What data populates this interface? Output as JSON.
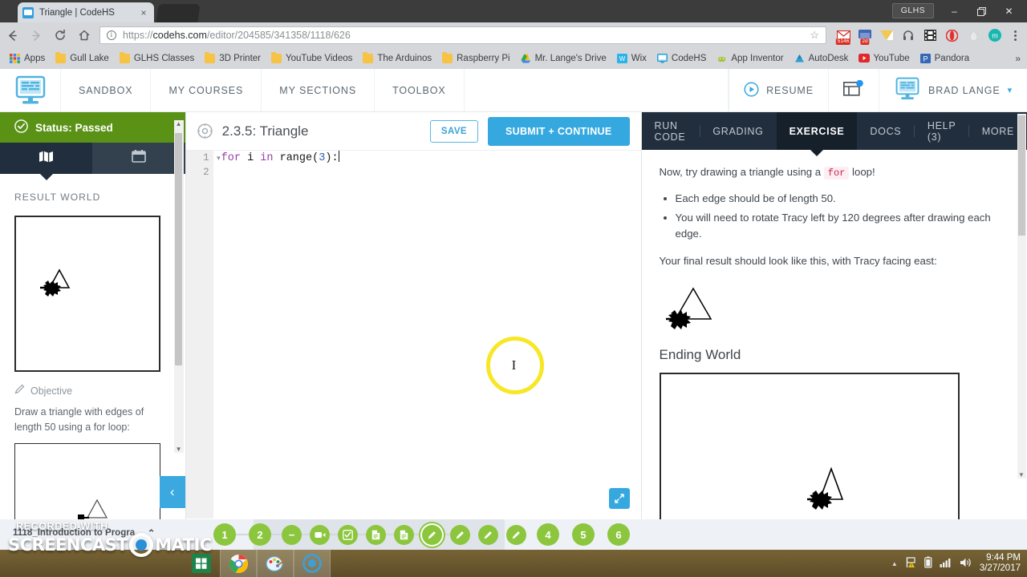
{
  "browser": {
    "tab": {
      "title": "Triangle | CodeHS",
      "favicon": "codehs-icon",
      "close": "×"
    },
    "url": {
      "scheme": "https://",
      "domain": "codehs.com",
      "path": "/editor/204585/341358/1118/626"
    },
    "nav": {
      "back": "←",
      "forward": "→",
      "reload": "⟳",
      "home": "⌂",
      "star": "☆",
      "menu": "chrome-menu-icon"
    },
    "window": {
      "profile": "GLHS",
      "minimize": "–",
      "maximize": "❐",
      "close": "✕"
    },
    "extensions": [
      {
        "name": "gmail-extension-icon",
        "badge": "5146"
      },
      {
        "name": "facebook-extension-icon",
        "badge": "2d"
      },
      {
        "name": "mail-extension-icon",
        "badge": ""
      },
      {
        "name": "headphones-extension-icon",
        "badge": ""
      },
      {
        "name": "film-extension-icon",
        "badge": ""
      },
      {
        "name": "opera-extension-icon",
        "badge": ""
      },
      {
        "name": "water-drop-extension-icon",
        "badge": ""
      },
      {
        "name": "mega-extension-icon",
        "badge": ""
      }
    ],
    "bookmarks": [
      {
        "label": "Apps",
        "icon": "apps-grid-icon"
      },
      {
        "label": "Gull Lake",
        "icon": "folder-icon"
      },
      {
        "label": "GLHS Classes",
        "icon": "folder-icon"
      },
      {
        "label": "3D Printer",
        "icon": "folder-icon"
      },
      {
        "label": "YouTube Videos",
        "icon": "folder-icon"
      },
      {
        "label": "The Arduinos",
        "icon": "folder-icon"
      },
      {
        "label": "Raspberry Pi",
        "icon": "folder-icon"
      },
      {
        "label": "Mr. Lange's Drive",
        "icon": "google-drive-icon"
      },
      {
        "label": "Wix",
        "icon": "wix-icon"
      },
      {
        "label": "CodeHS",
        "icon": "codehs-icon"
      },
      {
        "label": "App Inventor",
        "icon": "app-inventor-icon"
      },
      {
        "label": "AutoDesk",
        "icon": "autodesk-icon"
      },
      {
        "label": "YouTube",
        "icon": "youtube-icon"
      },
      {
        "label": "Pandora",
        "icon": "pandora-icon"
      }
    ],
    "bookmarks_overflow": "»"
  },
  "appnav": {
    "logo": "codehs-logo-icon",
    "items": [
      {
        "label": "SANDBOX"
      },
      {
        "label": "MY COURSES"
      },
      {
        "label": "MY SECTIONS"
      },
      {
        "label": "TOOLBOX"
      }
    ],
    "resume": {
      "label": "RESUME",
      "icon": "play-circle-icon"
    },
    "notifications": {
      "icon": "window-notification-icon",
      "has_dot": true
    },
    "user": {
      "name": "BRAD LANGE",
      "avatar": "codehs-avatar-icon",
      "caret": "▾"
    }
  },
  "sidebar": {
    "status": {
      "label": "Status: Passed",
      "icon": "check-circle-icon",
      "color": "#5a9216"
    },
    "tabs": [
      {
        "name": "map-tab",
        "icon": "map-icon",
        "active": true
      },
      {
        "name": "calendar-tab",
        "icon": "calendar-icon",
        "active": false
      }
    ],
    "result_world_heading": "RESULT WORLD",
    "objective_label": "Objective",
    "objective_icon": "pencil-icon",
    "objective_text": "Draw a triangle with edges of length 50 using a for loop:",
    "collapse_icon": "‹"
  },
  "editor": {
    "gear_icon": "gear-icon",
    "title": "2.3.5: Triangle",
    "save_label": "SAVE",
    "submit_label": "SUBMIT + CONTINUE",
    "lines": [
      {
        "number": "1",
        "fold": "▾",
        "tokens": [
          {
            "t": "for",
            "c": "kw"
          },
          {
            "t": " ",
            "c": "pl"
          },
          {
            "t": "i",
            "c": "id"
          },
          {
            "t": " ",
            "c": "pl"
          },
          {
            "t": "in",
            "c": "op"
          },
          {
            "t": " ",
            "c": "pl"
          },
          {
            "t": "range",
            "c": "id"
          },
          {
            "t": "(",
            "c": "pl"
          },
          {
            "t": "3",
            "c": "num"
          },
          {
            "t": ")",
            "c": "pl"
          },
          {
            "t": ":",
            "c": "pl"
          }
        ]
      },
      {
        "number": "2",
        "fold": "",
        "tokens": []
      }
    ],
    "expand_icon": "expand-arrows-icon",
    "cursor_highlight": "#f7e725"
  },
  "rightpanel": {
    "tabs": [
      {
        "label": "RUN CODE",
        "active": false
      },
      {
        "label": "GRADING",
        "active": false
      },
      {
        "label": "EXERCISE",
        "active": true
      },
      {
        "label": "DOCS",
        "active": false
      },
      {
        "label": "HELP (3)",
        "active": false
      },
      {
        "label": "MORE",
        "active": false
      }
    ],
    "intro_before": "Now, try drawing a triangle using a ",
    "intro_code": "for",
    "intro_after": " loop!",
    "bullets": [
      "Each edge should be of length 50.",
      "You will need to rotate Tracy left by 120 degrees after drawing each edge."
    ],
    "result_note": "Your final result should look like this, with Tracy facing east:",
    "ending_world_heading": "Ending World"
  },
  "bottombar": {
    "breadcrumb": "1118_Introduction to Progra...",
    "breadcrumb_caret": "⌃",
    "steps_left": [
      "1",
      "2"
    ],
    "steps_mid": [
      {
        "icon": "minus-icon",
        "label": "−"
      },
      {
        "icon": "video-icon",
        "label": ""
      },
      {
        "icon": "check-square-icon",
        "label": ""
      },
      {
        "icon": "document-icon",
        "label": ""
      },
      {
        "icon": "document-icon",
        "label": ""
      },
      {
        "icon": "pencil-icon",
        "label": "",
        "current": true
      },
      {
        "icon": "pencil-icon",
        "label": ""
      },
      {
        "icon": "pencil-icon",
        "label": ""
      },
      {
        "icon": "pencil-icon",
        "label": ""
      }
    ],
    "steps_right": [
      "4",
      "5",
      "6"
    ],
    "accent": "#8cc63e"
  },
  "overlay": {
    "recorded_with": "RECORDED WITH",
    "brand_left": "SCREENCAST",
    "brand_right": "MATIC",
    "logo_icon": "record-circle-icon"
  },
  "taskbar": {
    "apps": [
      {
        "name": "windows-store-icon"
      },
      {
        "name": "chrome-icon",
        "active": true
      },
      {
        "name": "paint-icon",
        "active": true
      },
      {
        "name": "screencast-o-matic-icon",
        "active": true
      },
      {
        "name": "unknown-app-icon"
      }
    ],
    "tray": {
      "show_hidden": "▲",
      "icons": [
        "flag-warning-icon",
        "battery-icon",
        "wifi-icon",
        "volume-icon"
      ],
      "time": "9:44 PM",
      "date": "3/27/2017"
    }
  }
}
